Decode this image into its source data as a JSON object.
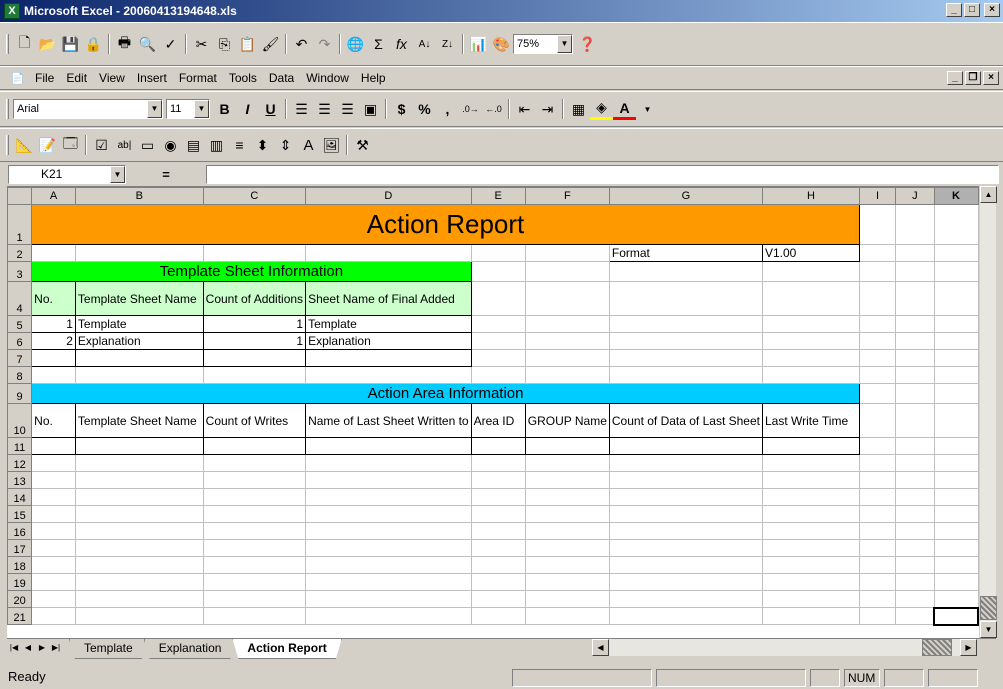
{
  "window": {
    "title": "Microsoft Excel - 20060413194648.xls",
    "app_icon_text": "X",
    "min": "_",
    "max": "□",
    "close": "×"
  },
  "menu": {
    "items": [
      {
        "label": "File"
      },
      {
        "label": "Edit"
      },
      {
        "label": "View"
      },
      {
        "label": "Insert"
      },
      {
        "label": "Format"
      },
      {
        "label": "Tools"
      },
      {
        "label": "Data"
      },
      {
        "label": "Window"
      },
      {
        "label": "Help"
      }
    ]
  },
  "standard_toolbar": {
    "zoom": "75%"
  },
  "formatting_toolbar": {
    "font": "Arial",
    "size": "11",
    "bold": "B",
    "italic": "I",
    "underline": "U",
    "currency": "$",
    "percent": "%",
    "comma": ","
  },
  "formula_bar": {
    "cell_ref": "K21",
    "equals": "="
  },
  "grid": {
    "columns": [
      "A",
      "B",
      "C",
      "D",
      "E",
      "F",
      "G",
      "H",
      "I",
      "J",
      "K"
    ],
    "rows": [
      "1",
      "2",
      "3",
      "4",
      "5",
      "6",
      "7",
      "8",
      "9",
      "10",
      "11",
      "12",
      "13",
      "14",
      "15",
      "16",
      "17",
      "18",
      "19",
      "20",
      "21"
    ],
    "title": "Action Report",
    "format_label": "Format",
    "format_value": "V1.00",
    "template_section": "Template Sheet Information",
    "template_headers": [
      "No.",
      "Template Sheet Name",
      "Count of Additions",
      "Sheet Name of Final Added"
    ],
    "template_rows": [
      [
        "1",
        "Template",
        "1",
        "Template"
      ],
      [
        "2",
        "Explanation",
        "1",
        "Explanation"
      ]
    ],
    "action_section": "Action Area Information",
    "action_headers": [
      "No.",
      "Template Sheet Name",
      "Count of Writes",
      "Name of Last Sheet Written to",
      "Area ID",
      "GROUP Name",
      "Count of Data of Last Sheet",
      "Last Write Time"
    ]
  },
  "tabs": [
    "Template",
    "Explanation",
    "Action Report"
  ],
  "status": {
    "text": "Ready",
    "num": "NUM"
  },
  "colors": {
    "title_bg": "#ff9900",
    "template_section_bg": "#00ff00",
    "template_header_bg": "#ccffcc",
    "action_section_bg": "#00ccff"
  }
}
